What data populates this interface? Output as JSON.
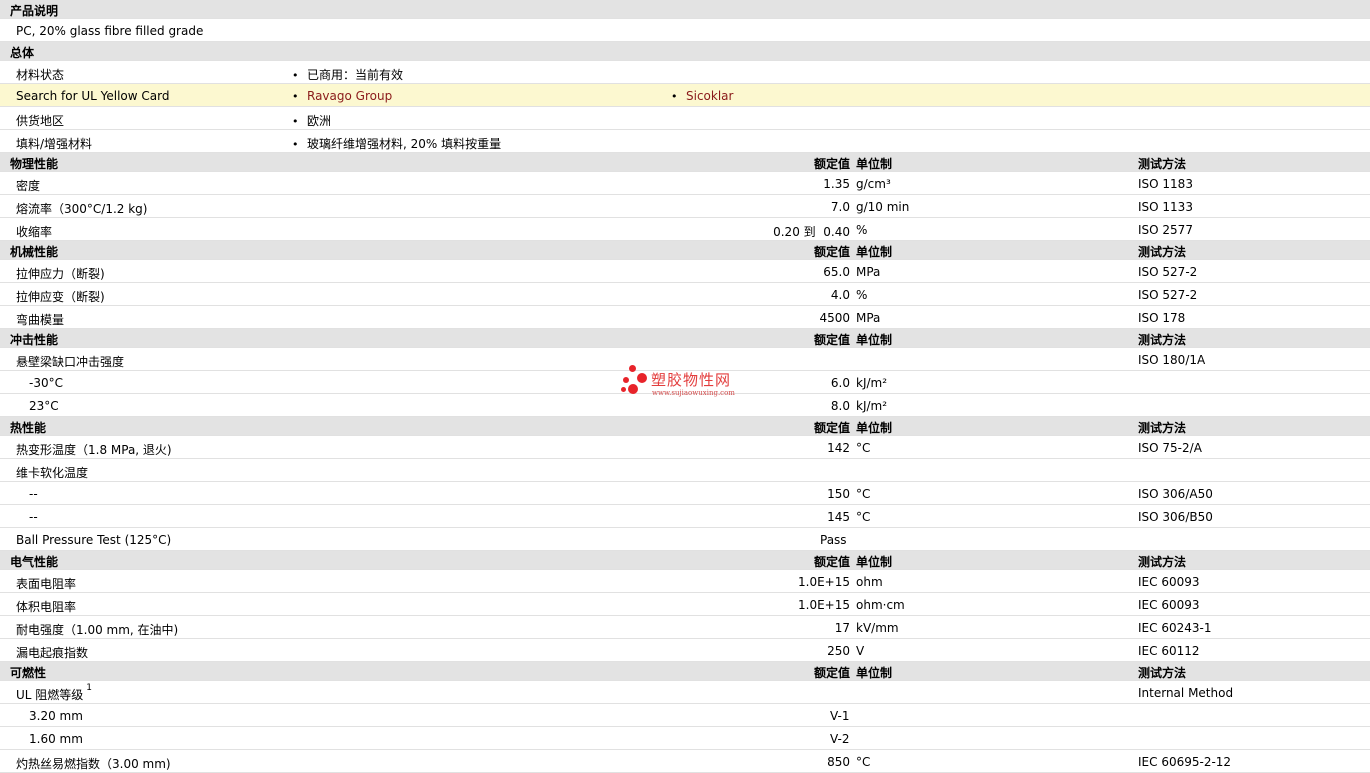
{
  "product_description": {
    "title": "产品说明",
    "text": "PC, 20% glass fibre filled grade"
  },
  "general": {
    "title": "总体",
    "rows": [
      {
        "label": "材料状态",
        "items": [
          "已商用：当前有效"
        ]
      },
      {
        "label": "Search for UL Yellow Card",
        "items": [
          "Ravago Group",
          "Sicoklar"
        ],
        "highlight": true,
        "links": true
      },
      {
        "label": "供货地区",
        "items": [
          "欧洲"
        ]
      },
      {
        "label": "填料/增强材料",
        "items": [
          "玻璃纤维增强材料, 20% 填料按重量"
        ]
      }
    ]
  },
  "headers": {
    "value": "额定值",
    "unit": "单位制",
    "test": "测试方法"
  },
  "physical": {
    "title": "物理性能",
    "rows": [
      {
        "label": "密度",
        "value": "1.35",
        "unit": "g/cm³",
        "test": "ISO 1183"
      },
      {
        "label": "熔流率（300°C/1.2 kg)",
        "value": "7.0",
        "unit": "g/10 min",
        "test": "ISO 1133"
      },
      {
        "label": "收缩率",
        "value": "0.20 到  0.40",
        "unit": "%",
        "test": "ISO 2577"
      }
    ]
  },
  "mechanical": {
    "title": "机械性能",
    "rows": [
      {
        "label": "拉伸应力（断裂)",
        "value": "65.0",
        "unit": "MPa",
        "test": "ISO 527-2"
      },
      {
        "label": "拉伸应变（断裂)",
        "value": "4.0",
        "unit": "%",
        "test": "ISO 527-2"
      },
      {
        "label": "弯曲模量",
        "value": "4500",
        "unit": "MPa",
        "test": "ISO 178"
      }
    ]
  },
  "impact": {
    "title": "冲击性能",
    "rows": [
      {
        "label": "悬壁梁缺口冲击强度",
        "value": "",
        "unit": "",
        "test": "ISO 180/1A"
      },
      {
        "label": "-30°C",
        "value": "6.0",
        "unit": "kJ/m²",
        "test": "",
        "sub": true
      },
      {
        "label": "23°C",
        "value": "8.0",
        "unit": "kJ/m²",
        "test": "",
        "sub": true
      }
    ]
  },
  "thermal": {
    "title": "热性能",
    "rows": [
      {
        "label": "热变形温度（1.8 MPa, 退火)",
        "value": "142",
        "unit": "°C",
        "test": "ISO 75-2/A"
      },
      {
        "label": "维卡软化温度",
        "value": "",
        "unit": "",
        "test": ""
      },
      {
        "label": "--",
        "value": "150",
        "unit": "°C",
        "test": "ISO 306/A50",
        "sub": true
      },
      {
        "label": "--",
        "value": "145",
        "unit": "°C",
        "test": "ISO 306/B50",
        "sub": true
      },
      {
        "label": "Ball Pressure Test (125°C)",
        "value": "Pass",
        "unit": "",
        "test": "",
        "leftval": true
      }
    ]
  },
  "electrical": {
    "title": "电气性能",
    "rows": [
      {
        "label": "表面电阻率",
        "value": "1.0E+15",
        "unit": "ohm",
        "test": "IEC 60093"
      },
      {
        "label": "体积电阻率",
        "value": "1.0E+15",
        "unit": "ohm·cm",
        "test": "IEC 60093"
      },
      {
        "label": "耐电强度（1.00 mm, 在油中)",
        "value": "17",
        "unit": "kV/mm",
        "test": "IEC 60243-1"
      },
      {
        "label": "漏电起痕指数",
        "value": "250",
        "unit": "V",
        "test": "IEC 60112"
      }
    ]
  },
  "flammability": {
    "title": "可燃性",
    "rows": [
      {
        "label": "UL 阻燃等级",
        "sup": "1",
        "value": "",
        "unit": "",
        "test": "Internal Method"
      },
      {
        "label": "3.20 mm",
        "value": "V-1",
        "unit": "",
        "test": "",
        "sub": true,
        "leftval": true
      },
      {
        "label": "1.60 mm",
        "value": "V-2",
        "unit": "",
        "test": "",
        "sub": true,
        "leftval": true
      },
      {
        "label": "灼热丝易燃指数（3.00 mm)",
        "value": "850",
        "unit": "°C",
        "test": "IEC 60695-2-12"
      }
    ]
  },
  "watermark": {
    "name": "塑胶物性网",
    "url": "www.sujiaowuxing.com",
    "color": "#e8232a"
  }
}
